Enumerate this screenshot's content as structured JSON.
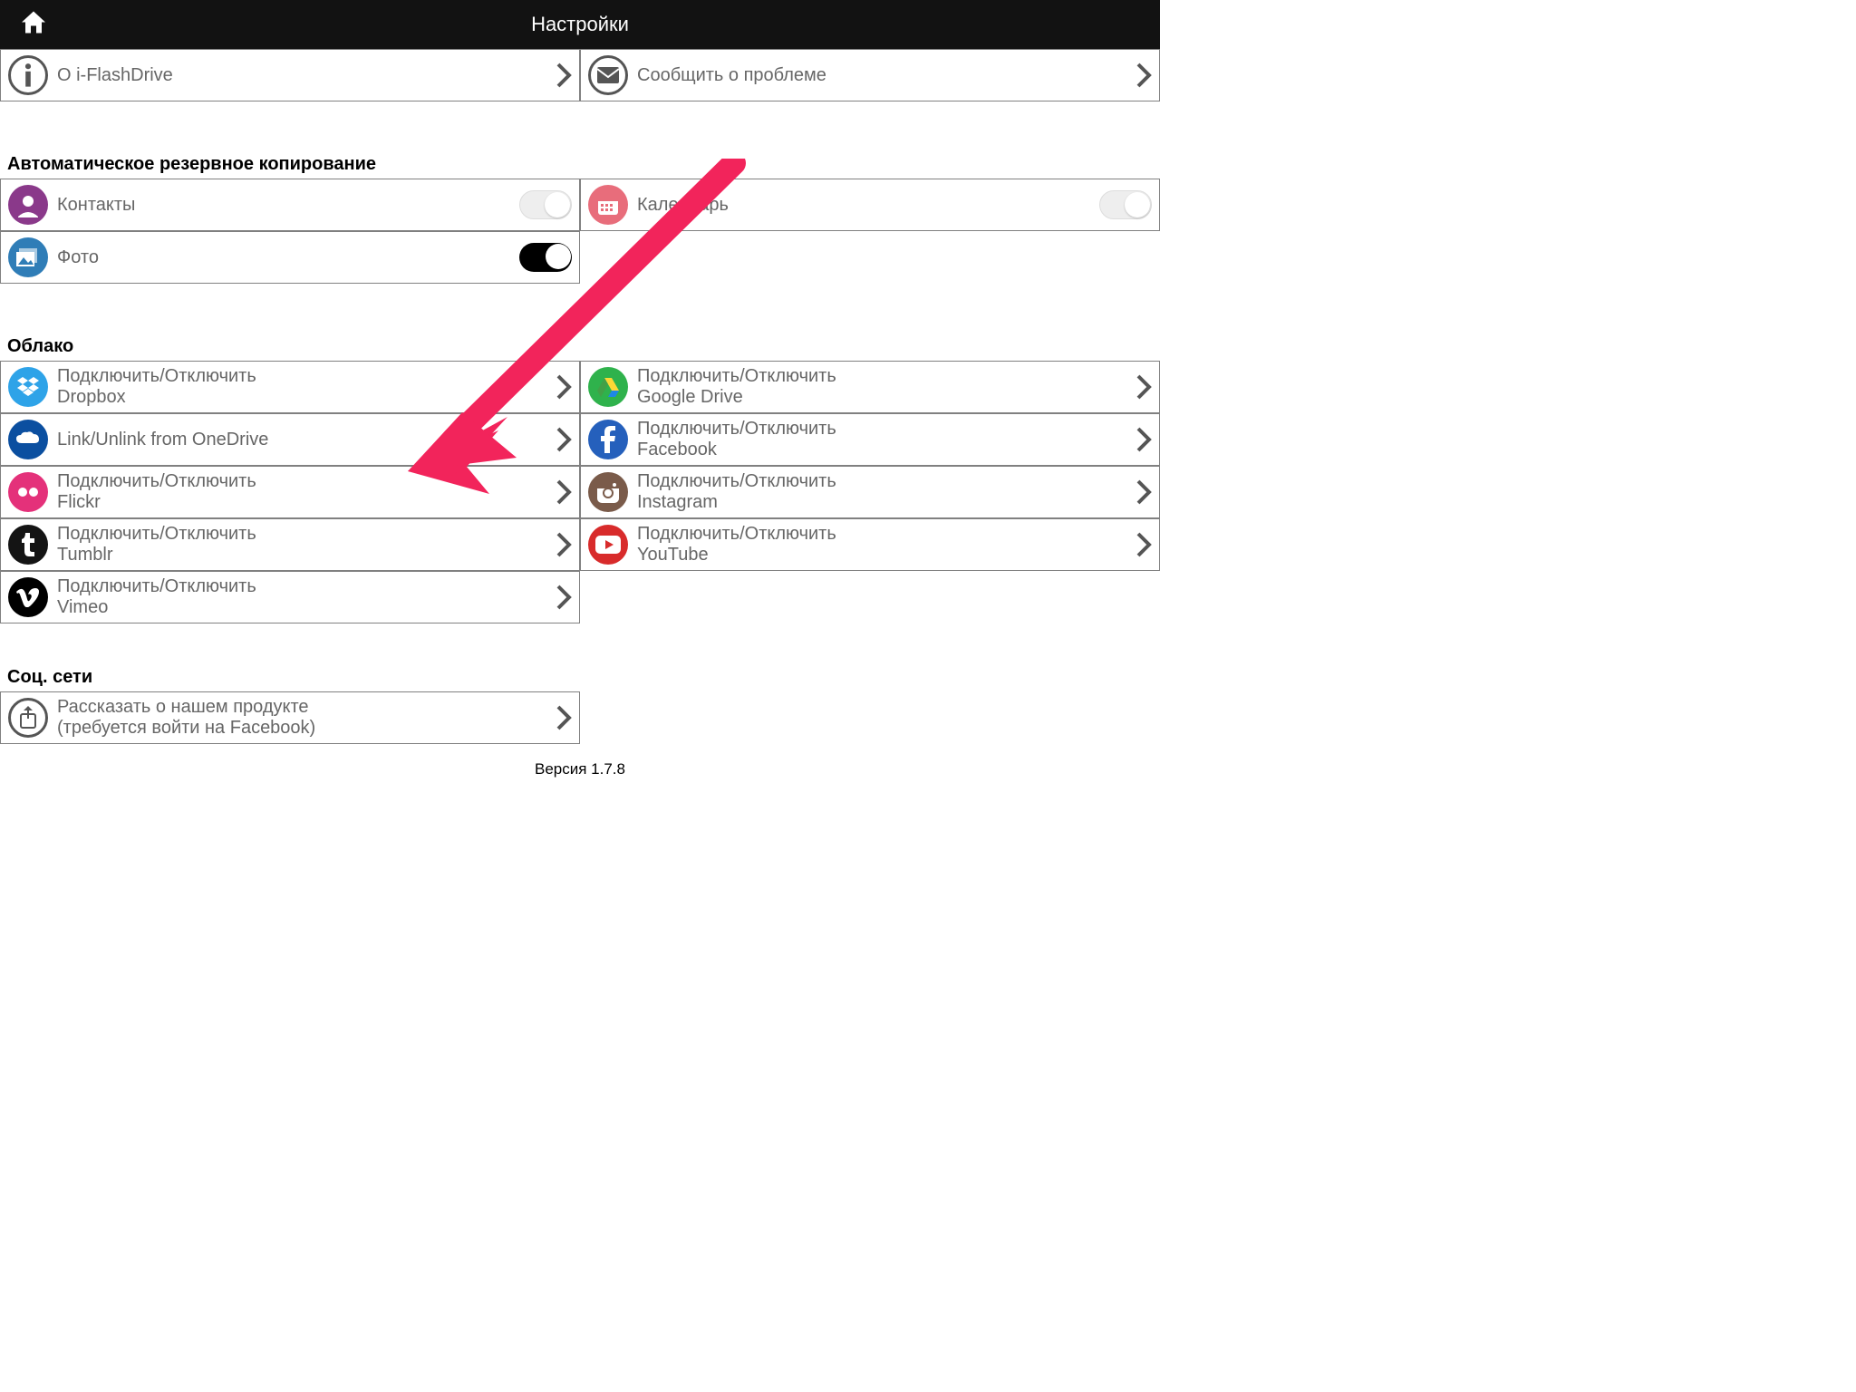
{
  "header": {
    "title": "Настройки"
  },
  "top": {
    "about": "О i-FlashDrive",
    "report": "Сообщить о проблеме"
  },
  "backup": {
    "title": "Автоматическое резервное копирование",
    "contacts": "Контакты",
    "calendar": "Календарь",
    "photo": "Фото"
  },
  "cloud": {
    "title": "Облако",
    "dropbox": "Подключить/Отключить\nDropbox",
    "gdrive": "Подключить/Отключить\nGoogle Drive",
    "onedrive": "Link/Unlink from OneDrive",
    "facebook": "Подключить/Отключить\nFacebook",
    "flickr": "Подключить/Отключить\nFlickr",
    "instagram": "Подключить/Отключить\nInstagram",
    "tumblr": "Подключить/Отключить\nTumblr",
    "youtube": "Подключить/Отключить\nYouTube",
    "vimeo": "Подключить/Отключить\nVimeo"
  },
  "social": {
    "title": "Соц. сети",
    "share": "Рассказать о нашем продукте\n(требуется войти на Facebook)"
  },
  "version": "Версия 1.7.8",
  "toggles": {
    "contacts": false,
    "calendar": false,
    "photo": true
  }
}
